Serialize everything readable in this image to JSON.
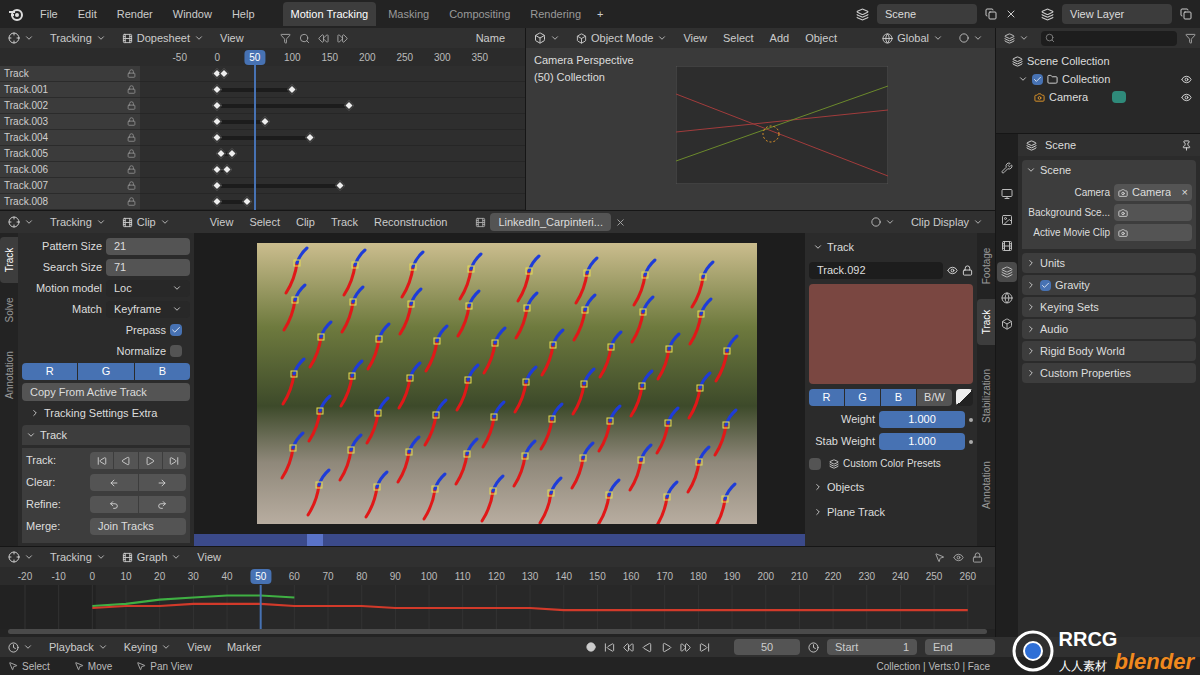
{
  "topbar": {
    "menus": [
      "File",
      "Edit",
      "Render",
      "Window",
      "Help"
    ],
    "workspaces": [
      {
        "label": "Motion Tracking",
        "selected": true
      },
      {
        "label": "Masking",
        "selected": false
      },
      {
        "label": "Compositing",
        "selected": false
      },
      {
        "label": "Rendering",
        "selected": false
      }
    ],
    "add_tab": "+",
    "scene": "Scene",
    "view_layer": "View Layer"
  },
  "dopesheet": {
    "mode": "Tracking",
    "editor": "Dopesheet",
    "menus": [
      "View"
    ],
    "filter": "Name",
    "current_frame": 50,
    "ruler": [
      {
        "label": "-50",
        "selected": false
      },
      {
        "label": "0",
        "selected": false
      },
      {
        "label": "50",
        "selected": true
      },
      {
        "label": "100",
        "selected": false
      },
      {
        "label": "150",
        "selected": false
      },
      {
        "label": "200",
        "selected": false
      },
      {
        "label": "250",
        "selected": false
      },
      {
        "label": "300",
        "selected": false
      },
      {
        "label": "350",
        "selected": false
      }
    ],
    "tracks": [
      {
        "name": "Track",
        "keys": [
          0,
          9
        ]
      },
      {
        "name": "Track.001",
        "keys": [
          0,
          100
        ]
      },
      {
        "name": "Track.002",
        "keys": [
          0,
          176
        ]
      },
      {
        "name": "Track.003",
        "keys": [
          0,
          63
        ]
      },
      {
        "name": "Track.004",
        "keys": [
          0,
          123
        ]
      },
      {
        "name": "Track.005",
        "keys": [
          5,
          19
        ]
      },
      {
        "name": "Track.006",
        "keys": [
          0,
          13
        ]
      },
      {
        "name": "Track.007",
        "keys": [
          0,
          163
        ]
      },
      {
        "name": "Track.008",
        "keys": [
          0,
          40
        ]
      }
    ]
  },
  "viewport": {
    "mode": "Object Mode",
    "menus": [
      "View",
      "Select",
      "Add",
      "Object"
    ],
    "orientation": "Global",
    "overlay": [
      "Camera Perspective",
      "(50) Collection"
    ]
  },
  "outliner": {
    "items": [
      {
        "label": "Scene Collection",
        "depth": 0,
        "kind": "scene",
        "enabled": false,
        "visible": false
      },
      {
        "label": "Collection",
        "depth": 1,
        "kind": "collection",
        "enabled": true,
        "visible": true
      },
      {
        "label": "Camera",
        "depth": 2,
        "kind": "camera",
        "enabled": false,
        "visible": true
      }
    ]
  },
  "properties": {
    "tabs": [
      {
        "selected": false
      },
      {
        "selected": false
      },
      {
        "selected": false
      },
      {
        "selected": false
      },
      {
        "selected": true
      },
      {
        "selected": false
      },
      {
        "selected": false
      }
    ],
    "header": "Scene",
    "section": "Scene",
    "fields": [
      {
        "label": "Camera",
        "value": "Camera",
        "clear": "×"
      },
      {
        "label": "Background Sce...",
        "value": "",
        "clear": ""
      },
      {
        "label": "Active Movie Clip",
        "value": "",
        "clear": ""
      }
    ],
    "subsections": [
      {
        "label": "Units",
        "kind": "plain",
        "checked": false
      },
      {
        "label": "Gravity",
        "kind": "check",
        "checked": true
      },
      {
        "label": "Keying Sets",
        "kind": "plain",
        "checked": false
      },
      {
        "label": "Audio",
        "kind": "plain",
        "checked": false
      },
      {
        "label": "Rigid Body World",
        "kind": "plain",
        "checked": false
      },
      {
        "label": "Custom Properties",
        "kind": "plain",
        "checked": false
      }
    ]
  },
  "clip": {
    "mode": "Tracking",
    "editor": "Clip",
    "menus": [
      "View",
      "Select",
      "Clip",
      "Track",
      "Reconstruction"
    ],
    "clip_name": "LinkedIn_Carpinteri...",
    "display": "Clip Display",
    "current_frame": 50,
    "tabs": [
      {
        "label": "Track",
        "selected": true
      },
      {
        "label": "Solve",
        "selected": false
      },
      {
        "label": "Annotation",
        "selected": false
      }
    ],
    "tool": {
      "fields": [
        {
          "kind": "number",
          "label": "Pattern Size",
          "value": "21",
          "checked": false
        },
        {
          "kind": "number",
          "label": "Search Size",
          "value": "71",
          "checked": false
        },
        {
          "kind": "dropdown",
          "label": "Motion model",
          "value": "Loc",
          "checked": false
        },
        {
          "kind": "dropdown",
          "label": "Match",
          "value": "Keyframe",
          "checked": false
        },
        {
          "kind": "check",
          "label": "Prepass",
          "value": "",
          "checked": true
        },
        {
          "kind": "check",
          "label": "Normalize",
          "value": "",
          "checked": false
        }
      ],
      "channels": [
        {
          "label": "R",
          "selected": true
        },
        {
          "label": "G",
          "selected": true
        },
        {
          "label": "B",
          "selected": true
        }
      ],
      "copy_button": "Copy From Active Track",
      "extra": {
        "label": "Tracking Settings Extra",
        "expanded": false
      },
      "track_section": {
        "label": "Track",
        "expanded": true,
        "rows": [
          {
            "label": "Track:",
            "kind": "track",
            "value": ""
          },
          {
            "label": "Clear:",
            "kind": "arrows",
            "value": ""
          },
          {
            "label": "Refine:",
            "kind": "undo",
            "value": ""
          },
          {
            "label": "Merge:",
            "kind": "button",
            "value": "Join Tracks"
          }
        ]
      }
    },
    "sidebar": {
      "title": "Track",
      "expanded": true,
      "track_name": "Track.092",
      "color": "#7a4741",
      "channels": [
        {
          "label": "R",
          "selected": true
        },
        {
          "label": "G",
          "selected": true
        },
        {
          "label": "B",
          "selected": true
        },
        {
          "label": "B/W",
          "selected": false
        }
      ],
      "weights": [
        {
          "label": "Weight",
          "value": "1.000",
          "level": 1
        },
        {
          "label": "Stab Weight",
          "value": "1.000",
          "level": 1
        }
      ],
      "presets": {
        "label": "Custom Color Presets",
        "checked": false
      },
      "sections": [
        {
          "label": "Objects",
          "expanded": false
        },
        {
          "label": "Plane Track",
          "expanded": false
        }
      ]
    },
    "sidebar_tabs": [
      {
        "label": "Footage",
        "selected": false
      },
      {
        "label": "Track",
        "selected": true
      },
      {
        "label": "Stabilization",
        "selected": false
      },
      {
        "label": "Annotation",
        "selected": false
      }
    ]
  },
  "graph": {
    "mode": "Tracking",
    "editor": "Graph",
    "menus": [
      "View"
    ],
    "ruler": [
      {
        "label": "-20",
        "selected": false
      },
      {
        "label": "-10",
        "selected": false
      },
      {
        "label": "0",
        "selected": false
      },
      {
        "label": "10",
        "selected": false
      },
      {
        "label": "20",
        "selected": false
      },
      {
        "label": "30",
        "selected": false
      },
      {
        "label": "40",
        "selected": false
      },
      {
        "label": "50",
        "selected": true
      },
      {
        "label": "60",
        "selected": false
      },
      {
        "label": "70",
        "selected": false
      },
      {
        "label": "80",
        "selected": false
      },
      {
        "label": "90",
        "selected": false
      },
      {
        "label": "100",
        "selected": false
      },
      {
        "label": "110",
        "selected": false
      },
      {
        "label": "120",
        "selected": false
      },
      {
        "label": "130",
        "selected": false
      },
      {
        "label": "140",
        "selected": false
      },
      {
        "label": "150",
        "selected": false
      },
      {
        "label": "160",
        "selected": false
      },
      {
        "label": "170",
        "selected": false
      },
      {
        "label": "180",
        "selected": false
      },
      {
        "label": "190",
        "selected": false
      },
      {
        "label": "200",
        "selected": false
      },
      {
        "label": "210",
        "selected": false
      },
      {
        "label": "220",
        "selected": false
      },
      {
        "label": "230",
        "selected": false
      },
      {
        "label": "240",
        "selected": false
      },
      {
        "label": "250",
        "selected": false
      },
      {
        "label": "260",
        "selected": false
      }
    ],
    "current_frame": 50,
    "series": [
      {
        "color": "#3fb043",
        "start": 0,
        "values": [
          2,
          3,
          5,
          6,
          7,
          7,
          6
        ]
      },
      {
        "color": "#d23a2a",
        "start": 0,
        "values": [
          1,
          2,
          2,
          3,
          3,
          3,
          2,
          2,
          2,
          1,
          1,
          1,
          1,
          1,
          0,
          0,
          0,
          0,
          0,
          0,
          0,
          0,
          0,
          0,
          0,
          0,
          0
        ]
      }
    ]
  },
  "timeline": {
    "menus": [
      {
        "label": "Playback",
        "dropdown": true
      },
      {
        "label": "Keying",
        "dropdown": true
      },
      {
        "label": "View",
        "dropdown": false
      },
      {
        "label": "Marker",
        "dropdown": false
      }
    ],
    "current": "50",
    "start_label": "Start",
    "start": "1",
    "end_label": "End"
  },
  "status": {
    "items": [
      "Select",
      "Move",
      "Pan View"
    ],
    "info": "Collection | Verts:0 | Face"
  },
  "watermark": {
    "brand": "RRCG",
    "cn": "人人素材",
    "app": "blender"
  }
}
